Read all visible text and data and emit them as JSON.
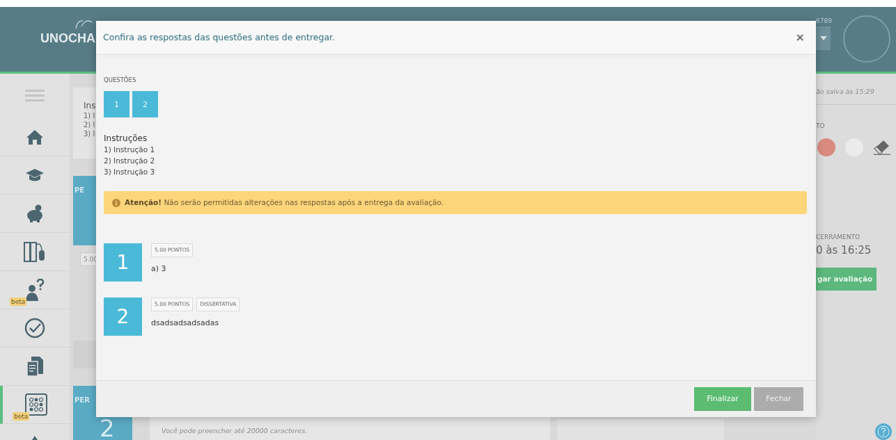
{
  "background_page": {
    "logo": "UNOCHA",
    "user_id_fragment": "6789",
    "sidebar": {
      "items": [
        {
          "selected": false
        },
        {
          "selected": false
        },
        {
          "selected": false
        },
        {
          "selected": false
        },
        {
          "badge": "beta",
          "selected": false
        },
        {
          "selected": false
        },
        {
          "selected": false
        },
        {
          "badge": "beta",
          "selected": true
        },
        {
          "selected": false
        }
      ]
    },
    "instructions_fragment": {
      "title": "Ins",
      "lines": [
        "1) I",
        "2) I",
        "3) I"
      ]
    },
    "question_cards": [
      {
        "label": "PE",
        "tag": "5.00"
      },
      {
        "label": "PER",
        "number": "2",
        "hint": "Você pode preencher até 20000 caracteres."
      }
    ],
    "side_panel": {
      "save_status": "ão salva às 15:29",
      "color_label": "TO",
      "colors": [
        {
          "color": "#d98b80"
        },
        {
          "color": "#ececec"
        }
      ],
      "closing_label": "CERRAMENTO",
      "closing_time": "0 às 16:25",
      "submit_button": "gar avaliação"
    }
  },
  "modal": {
    "title": "Confira as respostas das questões antes de entregar.",
    "close": "×",
    "questions_label": "QUESTÕES",
    "question_buttons": [
      "1",
      "2"
    ],
    "instructions_title": "Instruções",
    "instructions": [
      "1) Instrução 1",
      "2) Instrução 2",
      "3) Instrução 3"
    ],
    "alert": "**Atenção!** Não serão permitidas alterações nas respostas após a entrega da avaliação.",
    "answers": [
      {
        "number": "1",
        "tags": [
          "5.00 PONTOS"
        ],
        "answer": "a) 3"
      },
      {
        "number": "2",
        "tags": [
          "5.00 PONTOS",
          "DISSERTATIVA"
        ],
        "answer": "dsadsadsadsadas"
      }
    ],
    "buttons": [
      {
        "label": "Finalizar",
        "kind": "primary"
      },
      {
        "label": "Fechar",
        "kind": "secondary"
      }
    ]
  }
}
